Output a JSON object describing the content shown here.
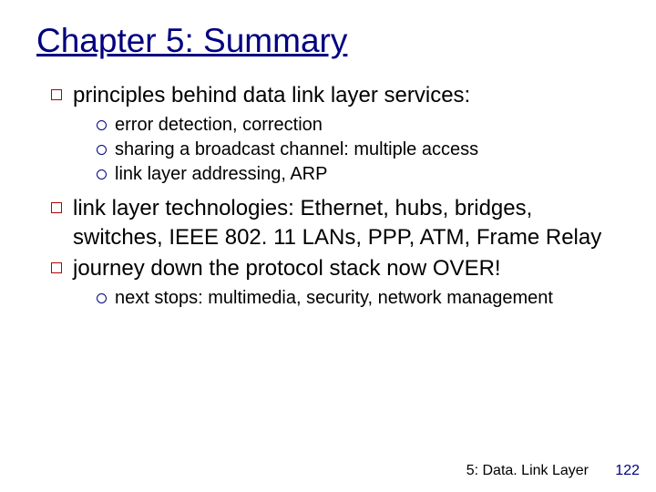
{
  "title": "Chapter 5: Summary",
  "bullets": [
    {
      "text": "principles behind data link layer services:",
      "sub": [
        "error detection, correction",
        "sharing a broadcast channel: multiple access",
        "link layer addressing, ARP"
      ]
    },
    {
      "text": "link layer technologies: Ethernet, hubs, bridges, switches, IEEE 802. 11 LANs, PPP, ATM, Frame Relay",
      "sub": []
    },
    {
      "text": "journey down the protocol stack now OVER!",
      "sub": [
        "next stops: multimedia, security, network management"
      ]
    }
  ],
  "footer": {
    "label": "5: Data. Link Layer",
    "page": "122"
  }
}
